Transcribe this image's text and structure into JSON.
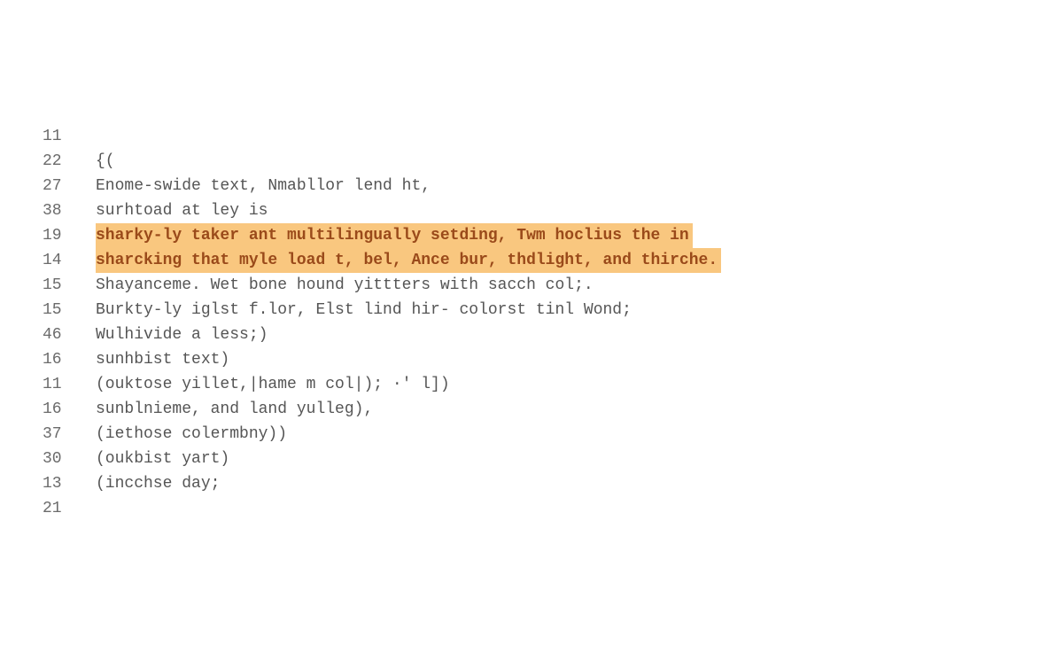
{
  "editor": {
    "highlight_color": "#f9c77f",
    "highlight_text_color": "#9a4a1a",
    "lines": [
      {
        "num": "11",
        "text": "",
        "highlight": false
      },
      {
        "num": "22",
        "text": "{(",
        "highlight": false
      },
      {
        "num": "27",
        "text": "Enome-swide text, Nmabllor lend ht,",
        "highlight": false
      },
      {
        "num": "38",
        "text": "surhtoad at ley is",
        "highlight": false
      },
      {
        "num": "19",
        "text": "sharky-ly taker ant multilingually setding, Twm hoclius the in",
        "highlight": true
      },
      {
        "num": "14",
        "text": "sharcking that myle load t, bel, Ance bur, thdlight, and thirche.",
        "highlight": true
      },
      {
        "num": "15",
        "text": "Shayanceme. Wet bone hound yittters with sacch col;.",
        "highlight": false
      },
      {
        "num": "15",
        "text": "Burkty-ly iglst f.lor, Elst lind hir- colorst tinl Wond;",
        "highlight": false
      },
      {
        "num": "46",
        "text": "Wulhivide a less;)",
        "highlight": false
      },
      {
        "num": "16",
        "text": "sunhbist text)",
        "highlight": false
      },
      {
        "num": "11",
        "text": "(ouktose yillet,|hame m col|); ·' l])",
        "highlight": false
      },
      {
        "num": "16",
        "text": "sunblnieme, and land yulleg),",
        "highlight": false
      },
      {
        "num": "37",
        "text": "(iethose colermbny))",
        "highlight": false
      },
      {
        "num": "30",
        "text": "(oukbist yart)",
        "highlight": false
      },
      {
        "num": "13",
        "text": "(incchse day;",
        "highlight": false
      },
      {
        "num": "21",
        "text": "",
        "highlight": false
      }
    ]
  }
}
